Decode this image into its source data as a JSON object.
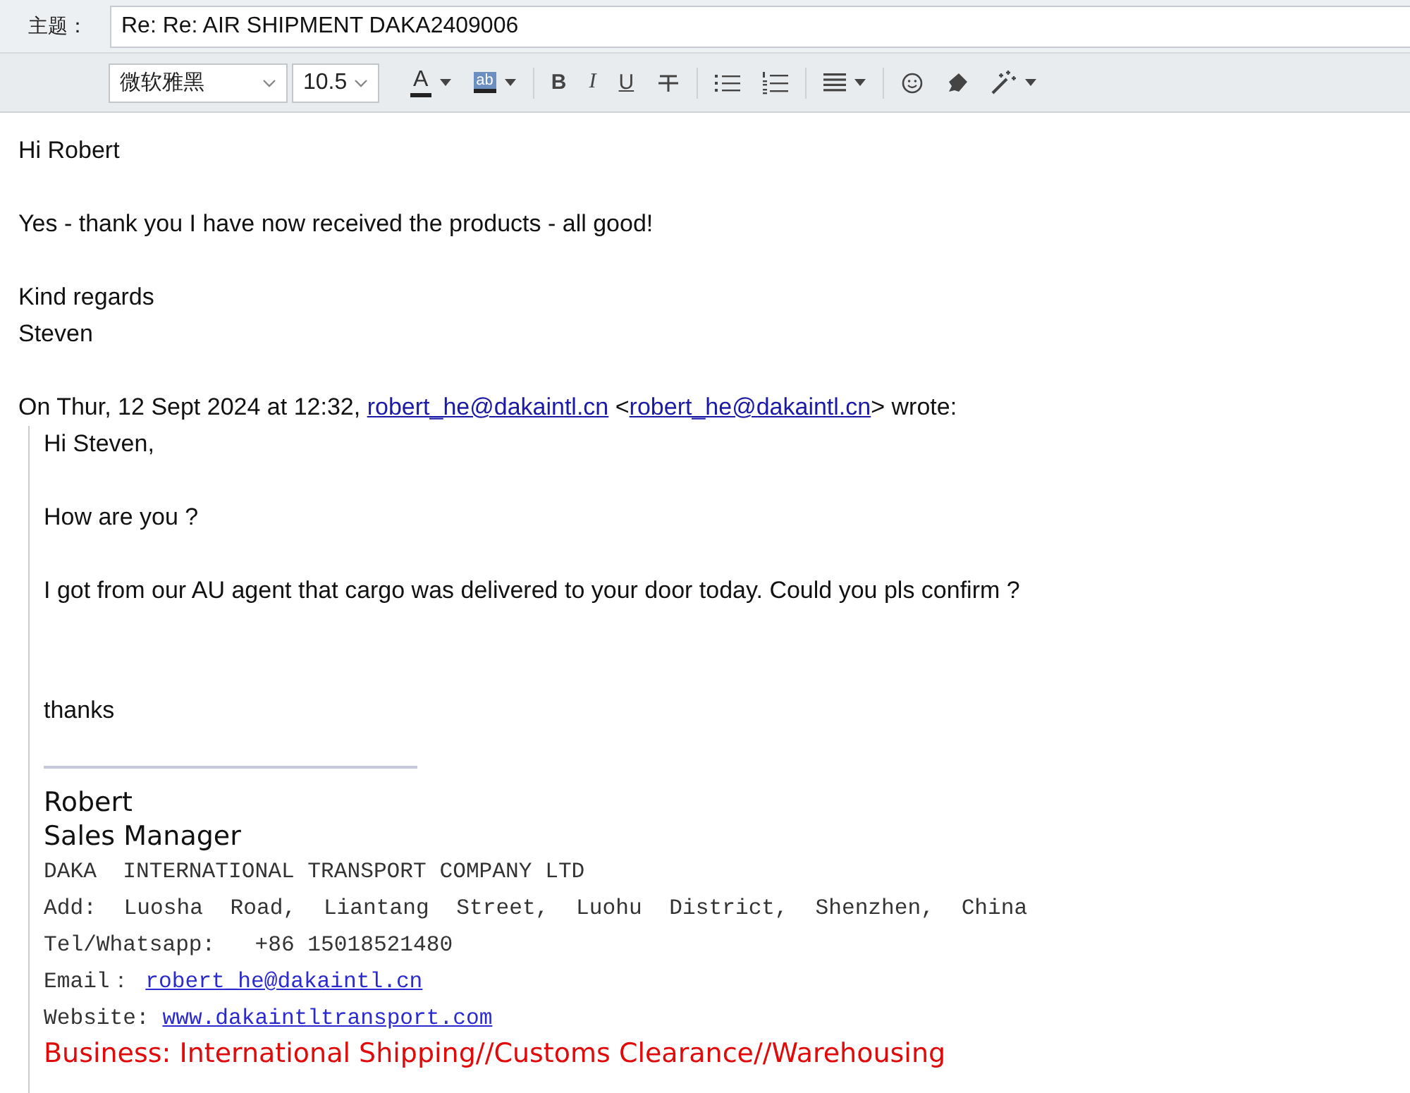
{
  "subject": {
    "label": "主题：",
    "value": "Re: Re: AIR SHIPMENT DAKA2409006"
  },
  "toolbar": {
    "font": "微软雅黑",
    "size": "10.5",
    "tools": [
      {
        "kind": "font-color",
        "label": "A",
        "dropdown": true
      },
      {
        "kind": "highlight",
        "label": "ab",
        "dropdown": true
      },
      {
        "kind": "separator"
      },
      {
        "kind": "bold",
        "label": "B"
      },
      {
        "kind": "italic",
        "label": "I"
      },
      {
        "kind": "underline",
        "label": "U"
      },
      {
        "kind": "strike"
      },
      {
        "kind": "separator"
      },
      {
        "kind": "bullets"
      },
      {
        "kind": "numbering"
      },
      {
        "kind": "separator"
      },
      {
        "kind": "align",
        "dropdown": true
      },
      {
        "kind": "separator"
      },
      {
        "kind": "emoji"
      },
      {
        "kind": "clear"
      },
      {
        "kind": "magic",
        "dropdown": true
      }
    ]
  },
  "message": {
    "paragraphs": [
      [
        "Hi Robert"
      ],
      [
        "Yes - thank you I have now received the products - all good!"
      ],
      [
        "Kind regards",
        "Steven"
      ]
    ],
    "attribution": [
      {
        "text": "On Thur, 12 Sept 2024 at 12:32, "
      },
      {
        "link": "robert_he@dakaintl.cn"
      },
      {
        "text": " <"
      },
      {
        "link": "robert_he@dakaintl.cn"
      },
      {
        "text": "> wrote:"
      }
    ],
    "quote": {
      "paragraphs": [
        {
          "kind": "plain",
          "lines": [
            "Hi Steven,"
          ]
        },
        {
          "kind": "plain",
          "lines": [
            "How are you ?"
          ]
        },
        {
          "kind": "plain",
          "lines": [
            "I got from our AU agent that cargo was delivered to your door today. Could you pls confirm ?"
          ]
        },
        {
          "kind": "closing",
          "lines": [
            "thanks"
          ]
        }
      ],
      "signature": {
        "name": "Robert",
        "title": "Sales Manager",
        "lines": [
          {
            "kind": "plain",
            "text": "DAKA  INTERNATIONAL TRANSPORT COMPANY LTD"
          },
          {
            "kind": "spaced",
            "text": "Add: Luosha Road, Liantang Street, Luohu District, Shenzhen, China"
          },
          {
            "kind": "plain",
            "text": "Tel/Whatsapp:   +86 15018521480"
          },
          {
            "kind": "link",
            "text": "Email： ",
            "link": "robert_he@dakaintl.cn"
          },
          {
            "kind": "link",
            "text": "Website: ",
            "link": "www.dakaintltransport.com"
          },
          {
            "kind": "business",
            "text": "Business: International Shipping//Customs Clearance//Warehousing"
          }
        ]
      }
    }
  }
}
